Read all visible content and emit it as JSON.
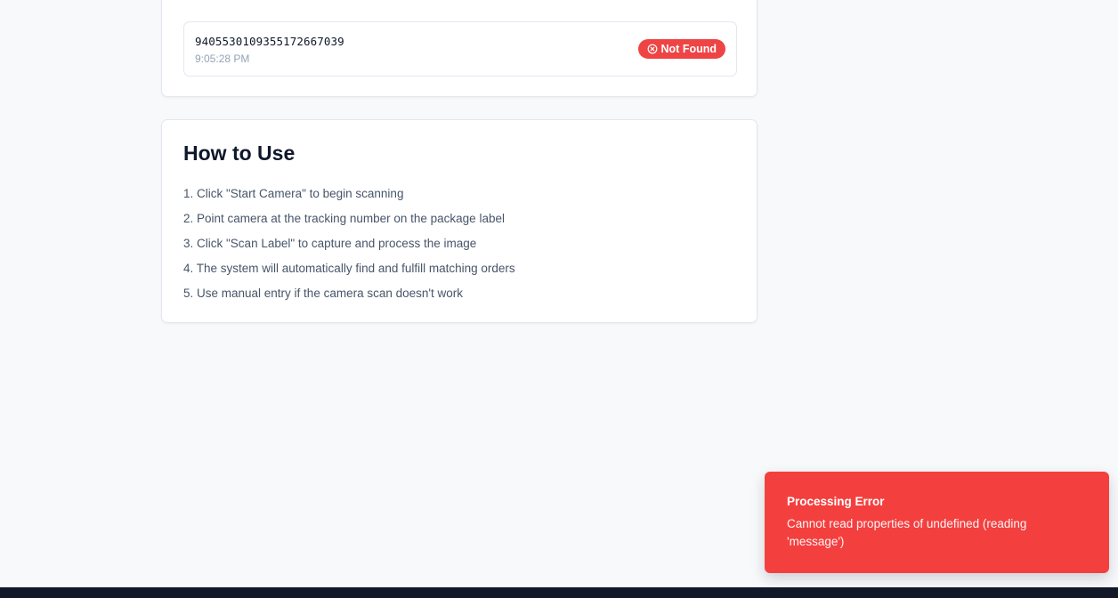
{
  "recent_scans": {
    "items": [
      {
        "tracking_number": "9405530109355172667039",
        "time": "9:05:28 PM",
        "status": "Not Found"
      }
    ]
  },
  "how_to_use": {
    "title": "How to Use",
    "steps": [
      "1. Click \"Start Camera\" to begin scanning",
      "2. Point camera at the tracking number on the package label",
      "3. Click \"Scan Label\" to capture and process the image",
      "4. The system will automatically find and fulfill matching orders",
      "5. Use manual entry if the camera scan doesn't work"
    ]
  },
  "toast": {
    "title": "Processing Error",
    "message": "Cannot read properties of undefined (reading 'message')"
  },
  "colors": {
    "error": "#ef4444",
    "page_background": "#f8f9fb",
    "footer": "#111827"
  },
  "icons": {
    "status_icon": "x-circle-icon"
  }
}
